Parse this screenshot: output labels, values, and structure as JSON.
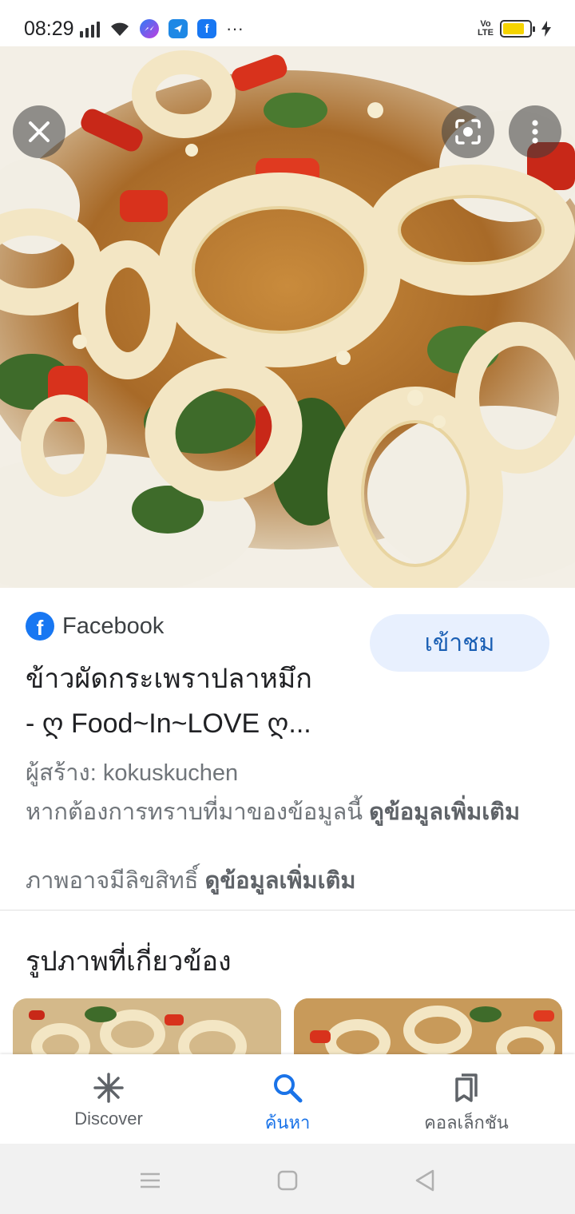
{
  "status_bar": {
    "time": "08:29",
    "more": "···",
    "volte_top": "Vo",
    "volte_bottom": "LTE",
    "battery_level": 0.8,
    "battery_color": "#f5d400"
  },
  "image": {
    "close_icon": "close-icon",
    "lens_icon": "lens-icon",
    "more_icon": "more-vert-icon"
  },
  "result": {
    "source_name": "Facebook",
    "visit_label": "เข้าชม",
    "title_line1": "ข้าวผัดกระเพราปลาหมึก",
    "title_line2": "- ღ Food~In~LOVE ღ...",
    "creator": "ผู้สร้าง: kokuskuchen",
    "source_info_text": "หากต้องการทราบที่มาของข้อมูลนี้ ",
    "source_info_link": "ดูข้อมูลเพิ่มเติม",
    "copyright_text": "ภาพอาจมีลิขสิทธิ์ ",
    "copyright_link": "ดูข้อมูลเพิ่มเติม"
  },
  "related": {
    "heading": "รูปภาพที่เกี่ยวข้อง"
  },
  "bottom_nav": {
    "items": [
      {
        "label": "Discover",
        "icon": "asterisk-icon"
      },
      {
        "label": "ค้นหา",
        "icon": "search-icon",
        "active": true
      },
      {
        "label": "คอลเล็กชัน",
        "icon": "bookmarks-icon"
      }
    ],
    "active_color": "#1a73e8"
  }
}
